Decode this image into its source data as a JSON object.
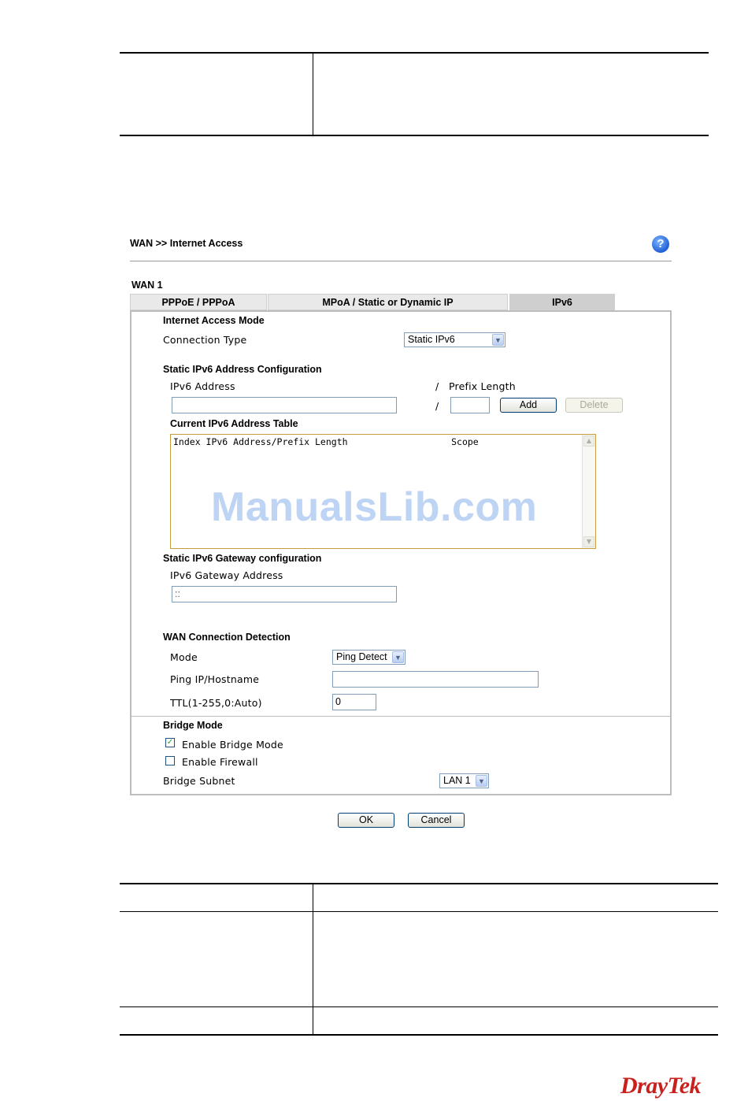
{
  "breadcrumb": "WAN >> Internet Access",
  "help_icon": "help-icon",
  "wan_label": "WAN 1",
  "tabs": [
    {
      "label": "PPPoE / PPPoA"
    },
    {
      "label": "MPoA / Static or Dynamic IP"
    },
    {
      "label": "IPv6",
      "active": true
    }
  ],
  "internet_access": {
    "title": "Internet Access Mode",
    "connection_type_label": "Connection Type",
    "connection_type_value": "Static IPv6"
  },
  "static_config": {
    "title": "Static IPv6 Address Configuration",
    "ipv6_address_label": "IPv6 Address",
    "slash": "/",
    "prefix_label": "Prefix Length",
    "ipv6_address_value": "",
    "prefix_value": "",
    "add_button": "Add",
    "delete_button": "Delete"
  },
  "address_table": {
    "title": "Current IPv6 Address Table",
    "header": "Index IPv6 Address/Prefix Length                   Scope"
  },
  "gateway": {
    "title": "Static IPv6 Gateway configuration",
    "label": "IPv6 Gateway Address",
    "value": "::"
  },
  "wan_detection": {
    "title": "WAN Connection Detection",
    "mode_label": "Mode",
    "mode_value": "Ping Detect",
    "ping_label": "Ping IP/Hostname",
    "ping_value": "",
    "ttl_label": "TTL(1-255,0:Auto)",
    "ttl_value": "0"
  },
  "bridge": {
    "title": "Bridge Mode",
    "enable_bridge_label": "Enable Bridge Mode",
    "enable_bridge_checked": true,
    "enable_firewall_label": "Enable Firewall",
    "enable_firewall_checked": false,
    "subnet_label": "Bridge Subnet",
    "subnet_value": "LAN 1"
  },
  "buttons": {
    "ok": "OK",
    "cancel": "Cancel"
  },
  "watermark": "ManualsLib.com",
  "logo": "DrayTek",
  "colors": {
    "logo": "#c8201d",
    "textarea_border": "#c89b3f",
    "input_border": "#7f9db9"
  }
}
